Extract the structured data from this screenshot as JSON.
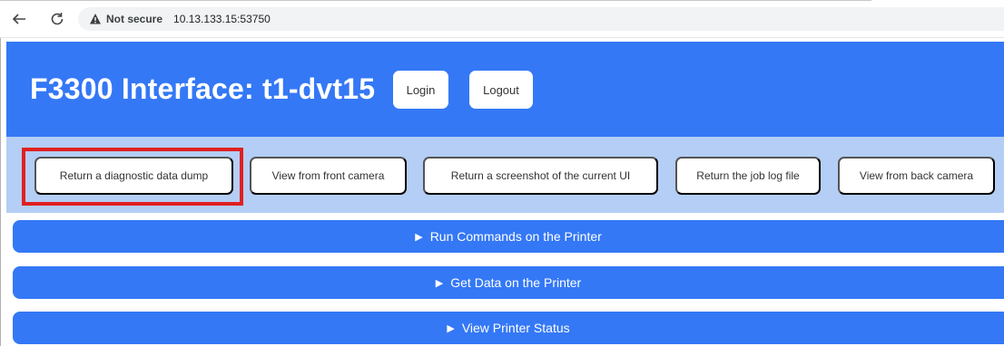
{
  "browser": {
    "back_icon": "arrow-left-icon",
    "reload_icon": "reload-icon",
    "security_label": "Not secure",
    "url": "10.13.133.15:53750"
  },
  "header": {
    "title": "F3300 Interface: t1-dvt15",
    "login_label": "Login",
    "logout_label": "Logout",
    "background_color": "#3478f6"
  },
  "toolbar": {
    "background_color": "#b4cef5",
    "buttons": [
      {
        "label": "Return a diagnostic data dump",
        "highlighted": true
      },
      {
        "label": "View from front camera"
      },
      {
        "label": "Return a screenshot of the current UI"
      },
      {
        "label": "Return the job log file"
      },
      {
        "label": "View from back camera"
      }
    ],
    "highlight_color": "#e02020"
  },
  "sections": [
    {
      "label": "Run Commands on the Printer",
      "icon": "triangle-right-icon"
    },
    {
      "label": "Get Data on the Printer",
      "icon": "triangle-right-icon"
    },
    {
      "label": "View Printer Status",
      "icon": "triangle-right-icon"
    }
  ]
}
